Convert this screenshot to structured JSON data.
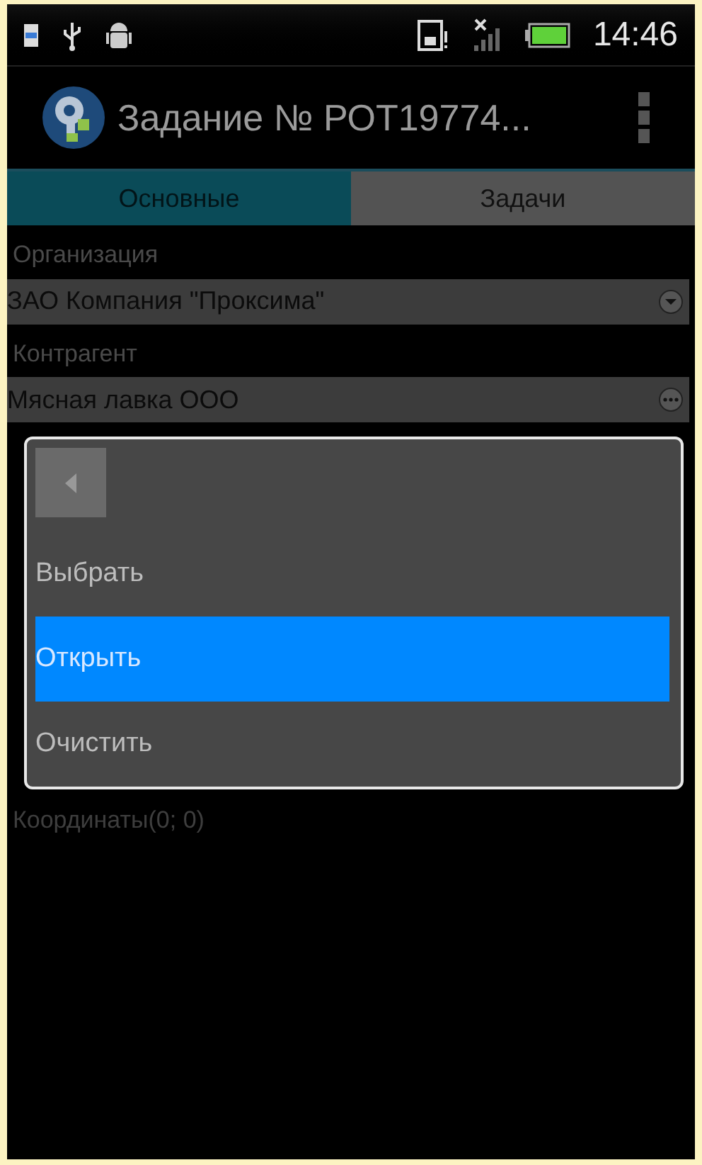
{
  "status_bar": {
    "time": "14:46"
  },
  "action_bar": {
    "title": "Задание № РОТ19774..."
  },
  "tabs": [
    {
      "label": "Основные",
      "selected": true
    },
    {
      "label": "Задачи",
      "selected": false
    }
  ],
  "fields": [
    {
      "label": "Организация",
      "value": "ЗАО Компания \"Проксима\"",
      "kind": "dropdown"
    },
    {
      "label": "Контрагент",
      "value": "Мясная лавка ООО",
      "kind": "reference"
    }
  ],
  "coordinates": "Координаты(0; 0)",
  "menu": {
    "items": [
      {
        "label": "Выбрать",
        "selected": false
      },
      {
        "label": "Открыть",
        "selected": true
      },
      {
        "label": "Очистить",
        "selected": false
      }
    ]
  }
}
